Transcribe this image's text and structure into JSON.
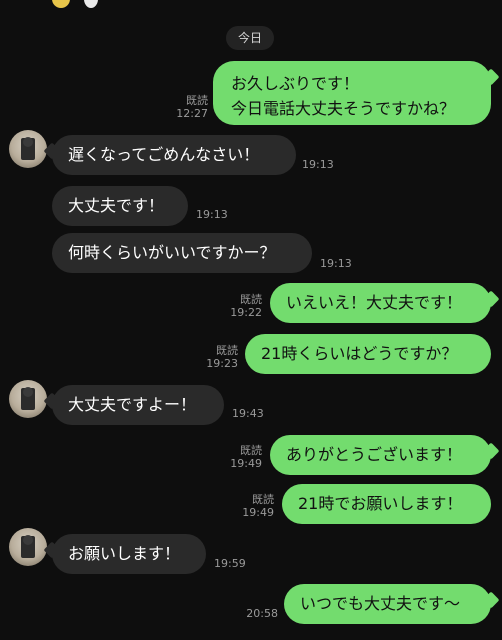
{
  "date_label": "今日",
  "messages": [
    {
      "side": "out",
      "text_lines": [
        "お久しぶりです！",
        "今日電話大丈夫そうですかね？"
      ],
      "read": "既読",
      "time": "12:27"
    },
    {
      "side": "in",
      "text": "遅くなってごめんなさい！",
      "time": "19:13"
    },
    {
      "side": "in",
      "text": "大丈夫です！",
      "time": "19:13"
    },
    {
      "side": "in",
      "text": "何時くらいがいいですかー？",
      "time": "19:13"
    },
    {
      "side": "out",
      "text": "いえいえ！大丈夫です！",
      "read": "既読",
      "time": "19:22"
    },
    {
      "side": "out",
      "text": "21時くらいはどうですか？",
      "read": "既読",
      "time": "19:23"
    },
    {
      "side": "in",
      "text": "大丈夫ですよー！",
      "time": "19:43"
    },
    {
      "side": "out",
      "text": "ありがとうございます！",
      "read": "既読",
      "time": "19:49"
    },
    {
      "side": "out",
      "text": "21時でお願いします！",
      "read": "既読",
      "time": "19:49"
    },
    {
      "side": "in",
      "text": "お願いします！",
      "time": "19:59"
    },
    {
      "side": "out",
      "text": "いつでも大丈夫です〜",
      "time": "20:58"
    }
  ],
  "colors": {
    "background": "#0e0e0e",
    "incoming_bubble": "#2a2a2a",
    "outgoing_bubble": "#73dc6e",
    "meta_text": "#9a9a9a"
  }
}
